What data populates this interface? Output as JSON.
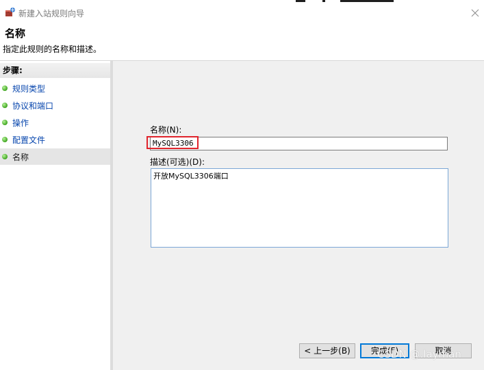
{
  "window": {
    "title": "新建入站规则向导",
    "close_icon": "close-icon",
    "app_icon": "firewall-wizard-icon"
  },
  "header": {
    "title": "名称",
    "description": "指定此规则的名称和描述。"
  },
  "steps": {
    "heading": "步骤:",
    "items": [
      {
        "label": "规则类型",
        "active": false
      },
      {
        "label": "协议和端口",
        "active": false
      },
      {
        "label": "操作",
        "active": false
      },
      {
        "label": "配置文件",
        "active": false
      },
      {
        "label": "名称",
        "active": true
      }
    ],
    "dot_color": "#3fa51f"
  },
  "form": {
    "name_label": "名称(N):",
    "name_value": "MySQL3306",
    "description_label": "描述(可选)(D):",
    "description_value": "开放MySQL3306端口"
  },
  "buttons": {
    "back": "< 上一步(B)",
    "finish": "完成(F)",
    "cancel": "取消"
  },
  "watermark": "CSDN @.layman",
  "colors": {
    "highlight": "#e0232b",
    "link": "#0645ad",
    "focus": "#0078d7"
  }
}
